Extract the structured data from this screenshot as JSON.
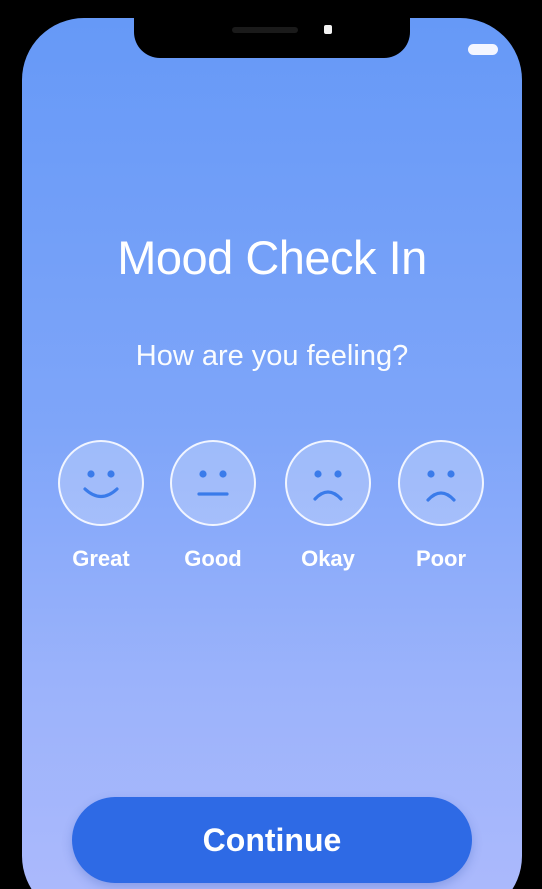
{
  "app": {
    "title": "Mood Check In",
    "prompt": "How are you feeling?"
  },
  "moods": [
    {
      "label": "Great",
      "icon": "smiling-face-icon"
    },
    {
      "label": "Good",
      "icon": "neutral-face-icon"
    },
    {
      "label": "Okay",
      "icon": "frowning-face-icon"
    },
    {
      "label": "Poor",
      "icon": "sad-face-icon"
    }
  ],
  "actions": {
    "continue_label": "Continue"
  },
  "colors": {
    "background_top": "#6699f7",
    "background_bottom": "#adbafc",
    "button": "#2e6ae5",
    "icon_stroke": "#3a7bea",
    "text": "#ffffff"
  }
}
